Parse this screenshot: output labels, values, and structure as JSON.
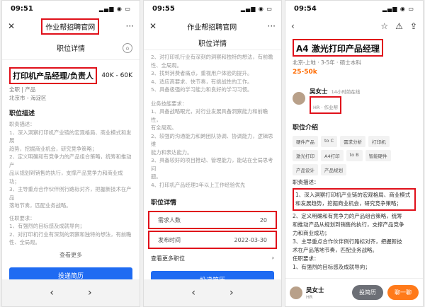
{
  "p1": {
    "time": "09:51",
    "title": "作业帮招聘官网",
    "header": "职位详情",
    "job_title": "打印机产品经理/负责人",
    "salary": "40K - 60K",
    "meta1": "全职 | 产品",
    "meta2": "北京市 - 海淀区",
    "sec_desc": "职位描述",
    "desc_lines": [
      "职责描述：",
      "1、深入洞察打印机产业链的宏观格局、商业模式和发展",
      "趋势，挖掘商业机会，研究竞争策略；",
      "2、定义明确和有竞争力的产品组合策略，统筹和推动产",
      "品从规划到销售的执行，支撑产品竞争力和商业成功；",
      "3、主导重点合作伙伴例行路标对齐，把握新技术在产品",
      "落地节奏，匹配业务战略。",
      "",
      "任职要求：",
      "1、有强烈的目标感及成就导向；",
      "2、对打印机行业有深刻的洞察和独特的想法，有前瞻",
      "性、全局观。"
    ],
    "see_more": "查看更多",
    "apply": "投递简历"
  },
  "p2": {
    "time": "09:55",
    "title": "作业帮招聘官网",
    "header": "职位详情",
    "lines": [
      "2、对打印机行业有深刻的洞察和独特的想法，有前瞻",
      "性、全局观。",
      "3、找到消费者痛点，重视用户体验的提升。",
      "4、适应高要求、快节奏，有挑战性的工作。",
      "5、具备极强的学习能力和良好的学习习惯。",
      "",
      "业务技能要求：",
      "1、具备战略眼光，对行业发展具备洞察能力和前瞻性，",
      "有全局观。",
      "2、较强的沟通能力和跨团队协调、协调能力，逻辑思维",
      "能力和表达能力。",
      "3、具备较好的项目推动、管理能力，能站在全局思考问",
      "题。",
      "4、打印机产品经理3年以上工作经验优先"
    ],
    "sec_detail": "职位详情",
    "need_label": "需求人数",
    "need_val": "20",
    "pub_label": "发布时间",
    "pub_val": "2022-03-30",
    "see_more_jobs": "查看更多职位",
    "apply": "投递简历"
  },
  "p3": {
    "time": "09:54",
    "job_title": "A4 激光打印产品经理",
    "meta": "北京-上地 · 3-5年 · 硕士本科",
    "salary": "25-50k",
    "hr_name": "吴女士",
    "hr_online": "14小时前在线",
    "hr_company": "HR · 作业帮",
    "sec_intro": "职位介绍",
    "tags": [
      "硬件产品",
      "to C",
      "需求分析",
      "打印机",
      "激光打印",
      "A4打印",
      "to B",
      "智能硬件",
      "产品设计",
      "产品规划"
    ],
    "desc_head": "职责描述：",
    "boxed1": "1、深入洞察打印机产业链的宏观格局、商业模式",
    "boxed2": "和发展趋势，挖掘商业机会，研究竞争策略；",
    "rest": [
      "2、定义明确和有竞争力的产品组合策略，统筹",
      "和推动产品从规划到销售的执行，支撑产品竞争",
      "力和商业成功；",
      "3、主导重点合作伙伴例行路标对齐，把握新技",
      "术在产品落地节奏，匹配业务战略。",
      "任职要求：",
      "1、有强烈的目标感及成就导向；"
    ],
    "bottom_name": "吴女士",
    "bottom_sub": "HR",
    "btn_apply": "投简历",
    "btn_chat": "聊一聊"
  }
}
